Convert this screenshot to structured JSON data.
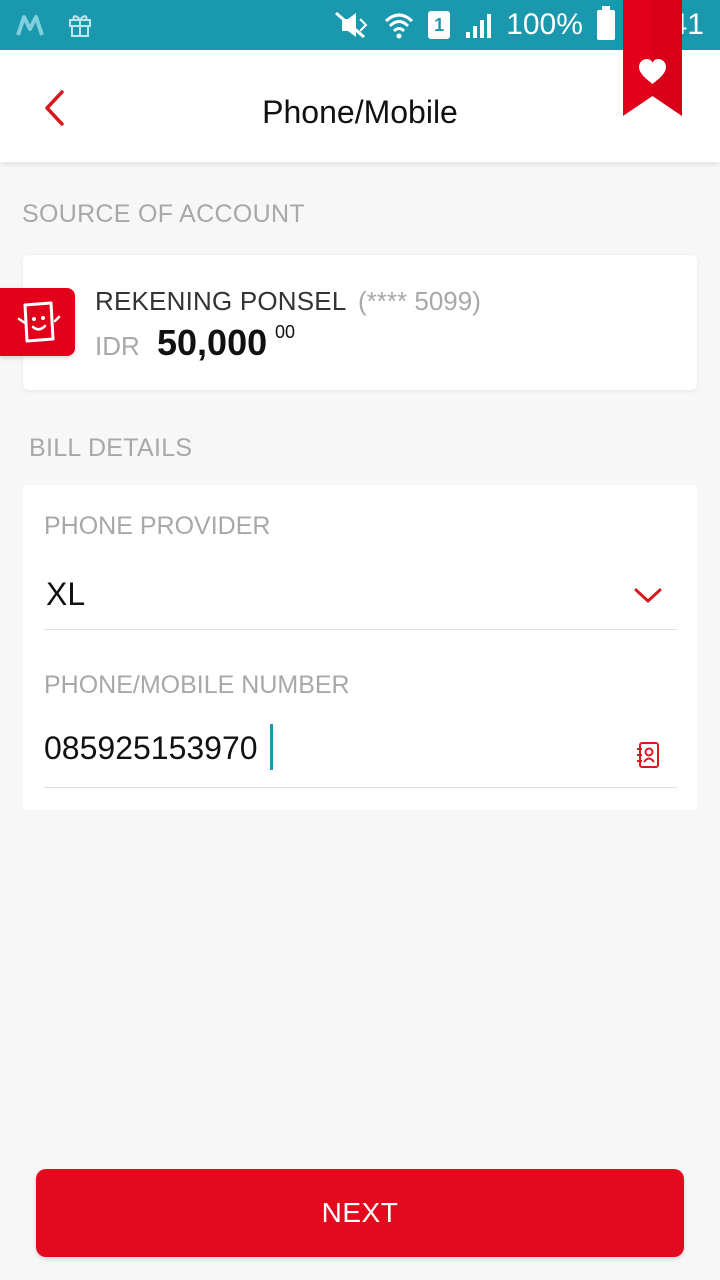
{
  "status_bar": {
    "battery_text": "100%",
    "time": "18:41",
    "sim_slot": "1",
    "icons": [
      "m-app-icon",
      "gift-icon",
      "mute-icon",
      "wifi-icon",
      "sim-icon",
      "signal-icon",
      "battery-icon"
    ]
  },
  "header": {
    "title": "Phone/Mobile",
    "back_icon": "chevron-left-icon",
    "favorite_icon": "heart-bookmark-icon"
  },
  "source_account": {
    "section_label": "SOURCE OF ACCOUNT",
    "account_name": "REKENING PONSEL",
    "account_mask": "(**** 5099)",
    "currency": "IDR",
    "balance": "50,000",
    "balance_cents": "00"
  },
  "bill_details": {
    "section_label": "BILL DETAILS",
    "provider_label": "PHONE PROVIDER",
    "provider_value": "XL",
    "number_label": "PHONE/MOBILE NUMBER",
    "number_value": "085925153970"
  },
  "actions": {
    "next_label": "NEXT"
  },
  "colors": {
    "status_bar": "#1a98ad",
    "brand_red": "#e30a1e",
    "muted_text": "#a8a8a8"
  }
}
